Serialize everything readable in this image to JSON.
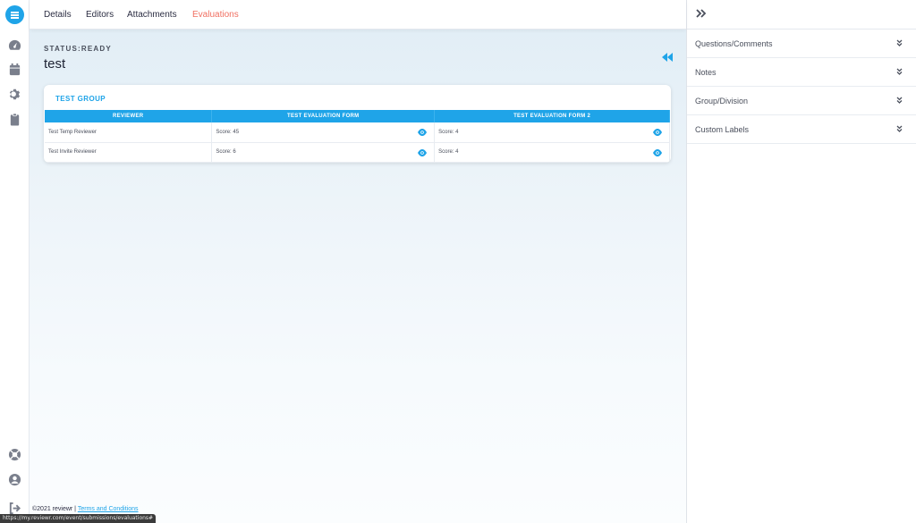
{
  "nav": {
    "tabs": [
      {
        "label": "Details"
      },
      {
        "label": "Editors"
      },
      {
        "label": "Attachments"
      },
      {
        "label": "Evaluations"
      }
    ],
    "active_tab": "Evaluations"
  },
  "rail_icons": [
    "logo-icon",
    "dashboard-icon",
    "calendar-icon",
    "gear-icon",
    "clipboard-icon",
    "help-icon",
    "user-icon",
    "logout-icon"
  ],
  "main": {
    "status": "STATUS:READY",
    "title": "test",
    "group": {
      "name": "TEST GROUP",
      "columns": [
        "REVIEWER",
        "TEST EVALUATION FORM",
        "TEST EVALUATION FORM 2"
      ],
      "rows": [
        {
          "reviewer": "Test Temp Reviewer",
          "form1": "Score: 45",
          "form2": "Score: 4"
        },
        {
          "reviewer": "Test Invite Reviewer",
          "form1": "Score: 6",
          "form2": "Score: 4"
        }
      ]
    }
  },
  "footer": {
    "copyright": "©2021 reviewr |",
    "link": "Terms and Conditions"
  },
  "status_url": "https://my.reviewr.com/event/submissions/evaluations#",
  "right_panel": {
    "sections": [
      {
        "label": "Questions/Comments"
      },
      {
        "label": "Notes"
      },
      {
        "label": "Group/Division"
      },
      {
        "label": "Custom Labels"
      }
    ]
  },
  "colors": {
    "accent": "#1fa4e8",
    "active_tab": "#f06f61",
    "text": "#2b2d42"
  }
}
